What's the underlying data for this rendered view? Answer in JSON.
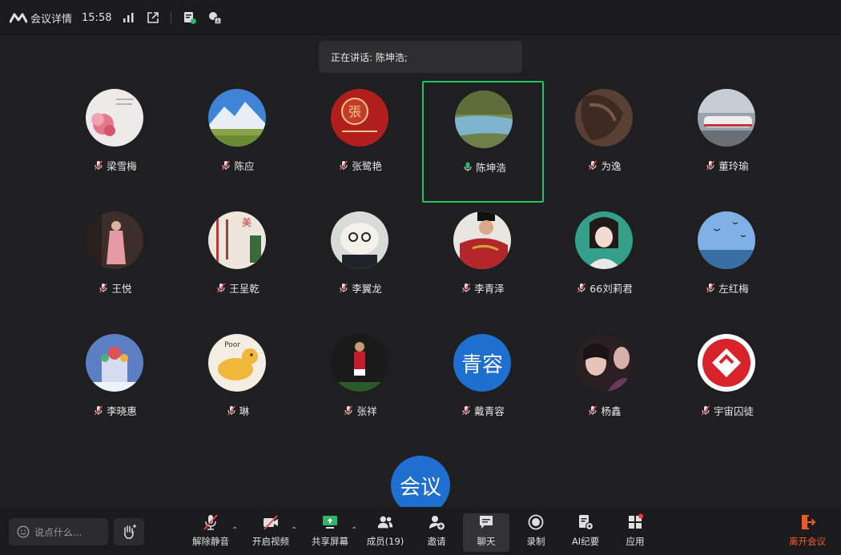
{
  "topbar": {
    "title": "会议详情",
    "time": "15:58",
    "icons": [
      "signal-icon",
      "popout-icon",
      "notes-icon",
      "translate-icon"
    ]
  },
  "speaking": {
    "text": "正在讲话: 陈坤浩;"
  },
  "participants": [
    {
      "name": "梁雪梅",
      "mic": "muted",
      "avatar": "flower"
    },
    {
      "name": "陈应",
      "mic": "muted",
      "avatar": "mountain"
    },
    {
      "name": "张鹭艳",
      "mic": "muted",
      "avatar": "redseal"
    },
    {
      "name": "陈坤浩",
      "mic": "speaking",
      "avatar": "river"
    },
    {
      "name": "为逸",
      "mic": "muted",
      "avatar": "hair"
    },
    {
      "name": "董玲瑜",
      "mic": "muted",
      "avatar": "train"
    },
    {
      "name": "王悦",
      "mic": "muted",
      "avatar": "girl"
    },
    {
      "name": "王呈乾",
      "mic": "muted",
      "avatar": "calligraphy"
    },
    {
      "name": "李翼龙",
      "mic": "muted",
      "avatar": "dog"
    },
    {
      "name": "李青泽",
      "mic": "muted",
      "avatar": "costume"
    },
    {
      "name": "66刘莉君",
      "mic": "muted",
      "avatar": "portrait"
    },
    {
      "name": "左红梅",
      "mic": "muted",
      "avatar": "sky"
    },
    {
      "name": "李晓惠",
      "mic": "muted",
      "avatar": "castle"
    },
    {
      "name": "琳",
      "mic": "muted",
      "avatar": "cartoon"
    },
    {
      "name": "张祥",
      "mic": "muted",
      "avatar": "soccer"
    },
    {
      "name": "戴青容",
      "mic": "muted",
      "avatar": "text",
      "avatar_text": "青容"
    },
    {
      "name": "杨鑫",
      "mic": "muted",
      "avatar": "women"
    },
    {
      "name": "宇宙囚徒",
      "mic": "muted",
      "avatar": "logo"
    }
  ],
  "floating": {
    "text": "会议"
  },
  "bottombar": {
    "chat_placeholder": "说点什么...",
    "buttons": {
      "unmute": "解除静音",
      "video": "开启视频",
      "share": "共享屏幕",
      "members": "成员(19)",
      "invite": "邀请",
      "chat": "聊天",
      "record": "录制",
      "ai": "AI纪要",
      "apps": "应用",
      "leave": "离开会议"
    }
  },
  "colors": {
    "accent": "#1f6fd1",
    "active_border": "#22c55e",
    "leave": "#f05a28",
    "badge": "#ff3b30"
  }
}
